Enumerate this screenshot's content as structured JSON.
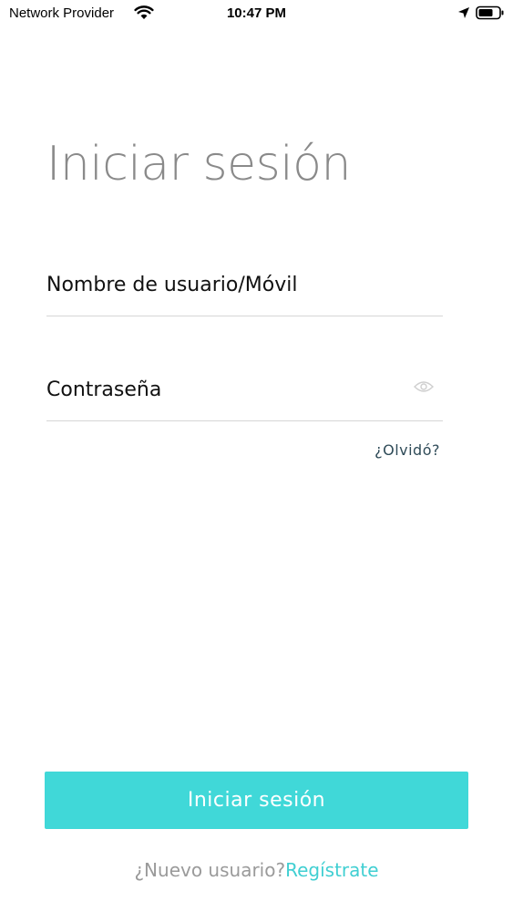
{
  "status_bar": {
    "carrier": "Network Provider",
    "time": "10:47 PM",
    "icons": [
      "wifi-icon",
      "location-icon",
      "battery-icon"
    ]
  },
  "login": {
    "title": "Iniciar sesión",
    "username_placeholder": "Nombre de usuario/Móvil",
    "username_value": "",
    "password_placeholder": "Contraseña",
    "password_value": "",
    "forgot_link": "¿Olvidó?",
    "submit_label": "Iniciar sesión",
    "new_user_prompt": "¿Nuevo usuario?",
    "register_link": "Regístrate"
  },
  "colors": {
    "accent": "#40d8d8",
    "title_gray": "#8a8a8a",
    "link_dark": "#2f4b58"
  }
}
